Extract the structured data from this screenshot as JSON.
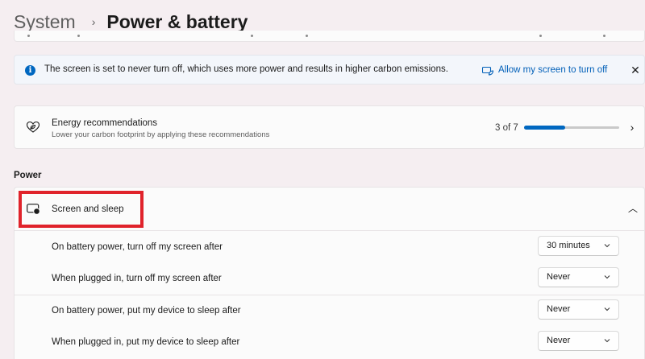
{
  "breadcrumb": {
    "parent": "System",
    "separator": "›",
    "current": "Power & battery"
  },
  "info_bar": {
    "message": "The screen is set to never turn off, which uses more power and results in higher carbon emissions.",
    "action_label": "Allow my screen to turn off",
    "close_glyph": "✕",
    "info_glyph": "i"
  },
  "energy": {
    "title": "Energy recommendations",
    "subtitle": "Lower your carbon footprint by applying these recommendations",
    "progress_text": "3 of 7",
    "progress_fraction": 0.43,
    "chevron": "›"
  },
  "power_section": {
    "title": "Power"
  },
  "screen_sleep": {
    "title": "Screen and sleep",
    "collapse_chevron": "︿",
    "settings": [
      {
        "label": "On battery power, turn off my screen after",
        "value": "30 minutes"
      },
      {
        "label": "When plugged in, turn off my screen after",
        "value": "Never"
      },
      {
        "label": "On battery power, put my device to sleep after",
        "value": "Never"
      },
      {
        "label": "When plugged in, put my device to sleep after",
        "value": "Never"
      }
    ]
  },
  "colors": {
    "accent": "#0067c0",
    "link": "#005fb8",
    "highlight_border": "#e0232b",
    "background": "#f5eef1"
  }
}
